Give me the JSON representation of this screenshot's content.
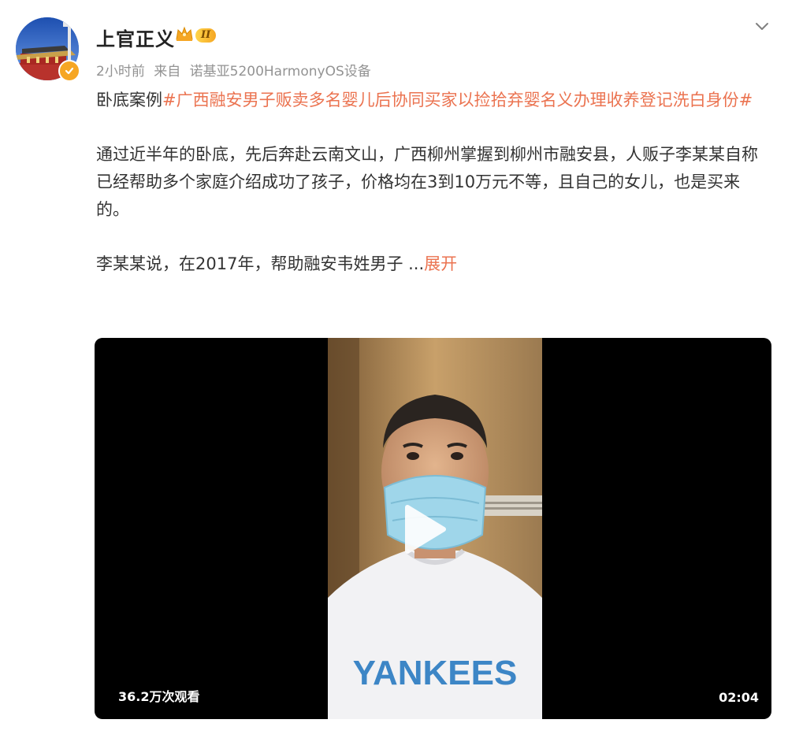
{
  "post": {
    "author": {
      "name": "上官正义",
      "vip_level": "II",
      "avatar_icon": "avatar-tiananmen",
      "verified_icon": "verified-check-icon"
    },
    "meta": {
      "time": "2小时前",
      "source_prefix": "来自",
      "device": "诺基亚5200HarmonyOS设备"
    },
    "text": {
      "lead": "卧底案例",
      "topic": "#广西融安男子贩卖多名婴儿后协同买家以捡拾弃婴名义办理收养登记洗白身份#",
      "paragraph_1": "通过近半年的卧底，先后奔赴云南文山，广西柳州掌握到柳州市融安县，人贩子李某某自称已经帮助多个家庭介绍成功了孩子，价格均在3到10万元不等，且自己的女儿，也是买来的。",
      "paragraph_2": "李某某说，在2017年，帮助融安韦姓男子 ...",
      "expand_label": "展开"
    },
    "video": {
      "views": "36.2万次观看",
      "duration": "02:04",
      "shirt_text": "YANKEES"
    },
    "colors": {
      "accent": "#eb7350",
      "meta_gray": "#939393",
      "verified": "#f6a623"
    }
  }
}
